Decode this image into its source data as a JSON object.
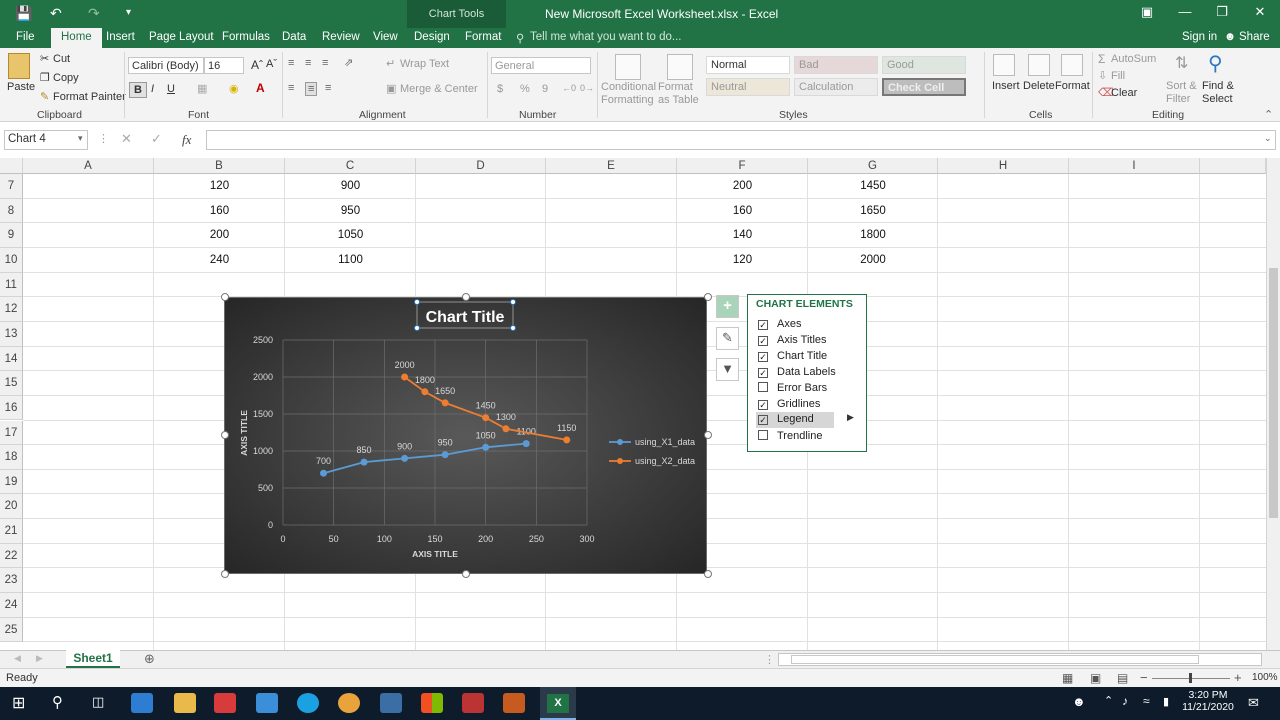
{
  "window": {
    "context_tab": "Chart Tools",
    "doc_title": "New Microsoft Excel Worksheet.xlsx - Excel"
  },
  "tabs": [
    "File",
    "Home",
    "Insert",
    "Page Layout",
    "Formulas",
    "Data",
    "Review",
    "View",
    "Design",
    "Format"
  ],
  "tell_me": "Tell me what you want to do...",
  "account": {
    "sign_in": "Sign in",
    "share": "Share"
  },
  "ribbon": {
    "clipboard": {
      "paste": "Paste",
      "cut": "Cut",
      "copy": "Copy",
      "format_painter": "Format Painter",
      "label": "Clipboard"
    },
    "font": {
      "name": "Calibri (Body)",
      "size": "16",
      "bold": "B",
      "italic": "I",
      "underline": "U",
      "label": "Font"
    },
    "alignment": {
      "wrap": "Wrap Text",
      "merge": "Merge & Center",
      "label": "Alignment"
    },
    "number": {
      "format": "General",
      "currency": "$",
      "percent": "%",
      "comma": "9",
      "label": "Number"
    },
    "styles": {
      "conditional": "Conditional Formatting",
      "format_table": "Format as Table",
      "normal": "Normal",
      "bad": "Bad",
      "good": "Good",
      "neutral": "Neutral",
      "calculation": "Calculation",
      "check_cell": "Check Cell",
      "label": "Styles"
    },
    "cells": {
      "insert": "Insert",
      "delete": "Delete",
      "format": "Format",
      "label": "Cells"
    },
    "editing": {
      "autosum": "AutoSum",
      "fill": "Fill",
      "clear": "Clear",
      "sort": "Sort & Filter",
      "find": "Find & Select",
      "label": "Editing"
    }
  },
  "name_box": "Chart 4",
  "fx": "fx",
  "columns": [
    "A",
    "B",
    "C",
    "D",
    "E",
    "F",
    "G",
    "H",
    "I"
  ],
  "rows": [
    "7",
    "8",
    "9",
    "10",
    "11",
    "12",
    "13",
    "14",
    "15",
    "16",
    "17",
    "18",
    "19",
    "20",
    "21",
    "22",
    "23",
    "24",
    "25"
  ],
  "cells": {
    "B": [
      "120",
      "160",
      "200",
      "240"
    ],
    "C": [
      "900",
      "950",
      "1050",
      "1100"
    ],
    "F": [
      "200",
      "160",
      "140",
      "120"
    ],
    "G": [
      "1450",
      "1650",
      "1800",
      "2000"
    ]
  },
  "chart_data": {
    "type": "scatter",
    "title": "Chart Title",
    "xlabel": "AXIS TITLE",
    "ylabel": "AXIS TITLE",
    "xlim": [
      0,
      300
    ],
    "ylim": [
      0,
      2500
    ],
    "x_ticks": [
      "0",
      "50",
      "100",
      "150",
      "200",
      "250",
      "300"
    ],
    "y_ticks": [
      "0",
      "500",
      "1000",
      "1500",
      "2000",
      "2500"
    ],
    "grid": true,
    "legend": "right",
    "series": [
      {
        "name": "using_X1_data",
        "color": "#5b9bd5",
        "x": [
          40,
          80,
          120,
          160,
          200,
          240
        ],
        "y": [
          700,
          850,
          900,
          950,
          1050,
          1100
        ]
      },
      {
        "name": "using_X2_data",
        "color": "#ed7d31",
        "x": [
          120,
          140,
          160,
          200,
          220,
          280
        ],
        "y": [
          2000,
          1800,
          1650,
          1450,
          1300,
          1150
        ]
      }
    ]
  },
  "chart_elements": {
    "heading": "CHART ELEMENTS",
    "items": [
      {
        "label": "Axes",
        "checked": true
      },
      {
        "label": "Axis Titles",
        "checked": true
      },
      {
        "label": "Chart Title",
        "checked": true
      },
      {
        "label": "Data Labels",
        "checked": true
      },
      {
        "label": "Error Bars",
        "checked": false
      },
      {
        "label": "Gridlines",
        "checked": true
      },
      {
        "label": "Legend",
        "checked": true
      },
      {
        "label": "Trendline",
        "checked": false
      }
    ]
  },
  "sheet_tab": "Sheet1",
  "status": {
    "ready": "Ready",
    "zoom": "100%"
  },
  "clock": {
    "time": "3:20 PM",
    "date": "11/21/2020"
  },
  "colors": {
    "excel_green": "#217346",
    "series1": "#5b9bd5",
    "series2": "#ed7d31"
  }
}
